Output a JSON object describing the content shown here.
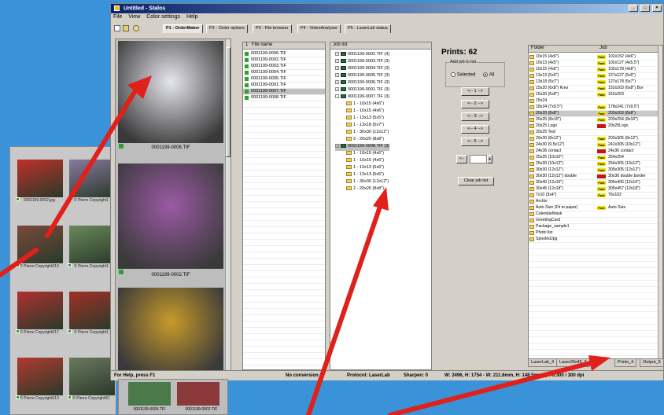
{
  "window": {
    "title": "Untitled - Stalos",
    "controls": [
      "_",
      "□",
      "×"
    ]
  },
  "menu": [
    "File",
    "View",
    "Color settings",
    "Help"
  ],
  "tabs": [
    "P1 - OrderMaker",
    "P2 - Order options",
    "P3 - File browser",
    "P4 - VideoAnalyser",
    "P5 - LaserLab status"
  ],
  "thumbnails": [
    {
      "caption": "0001199-0006.TIF",
      "color": "#e6e6ee"
    },
    {
      "caption": "0001199-0002.TIF",
      "color": "#9b5aa5"
    },
    {
      "caption": "",
      "color": "#c89a2a"
    }
  ],
  "bg_thumbnails": [
    {
      "caption": "0001199-0002.jpg",
      "color": "#c0302a"
    },
    {
      "caption": "© Pierre Copyright1",
      "color": "#8a7aa0"
    },
    {
      "caption": "© Pierre Copyright013",
      "color": "#7a4a3a"
    },
    {
      "caption": "© Pierre Copyright1",
      "color": "#6a8a5a"
    },
    {
      "caption": "© Pierre Copyright017",
      "color": "#b03030"
    },
    {
      "caption": "© Pierre Copyright1",
      "color": "#a03028"
    },
    {
      "caption": "© Pierre Copyright013",
      "color": "#b23a30"
    },
    {
      "caption": "© Pierre Copyright0C",
      "color": "#6a7a60"
    }
  ],
  "overlap_captions": [
    "0001199-0006.TIF",
    "0001199-0002.TIF"
  ],
  "filelist": {
    "header": "File name",
    "rows": [
      "0001199-0006.TIF",
      "0001199-0002.TIF",
      "0001199-0003.TIF",
      "0001199-0004.TIF",
      "0001199-0005.TIF",
      "0001199-0001.TIF",
      "0001199-0007.TIF",
      "0001199-0008.TIF"
    ],
    "selected_index": 6
  },
  "joblist": {
    "header": "Job list",
    "rows": [
      {
        "level": 0,
        "pm": "+",
        "text": "0001199-0002.TIF (3)"
      },
      {
        "level": 0,
        "pm": "+",
        "text": "0001199-0003.TIF (3)"
      },
      {
        "level": 0,
        "pm": "+",
        "text": "0001199-0004.TIF (3)"
      },
      {
        "level": 0,
        "pm": "+",
        "text": "0001199-0005.TIF (3)"
      },
      {
        "level": 0,
        "pm": "+",
        "text": "0001199-0006.TIF (3)"
      },
      {
        "level": 0,
        "pm": "+",
        "text": "0001199-0001.TIF (3)"
      },
      {
        "level": 0,
        "pm": "-",
        "text": "0001199-0007.TIF (3)"
      },
      {
        "level": 1,
        "pm": "",
        "text": "1 - 10x15 (4x6\")"
      },
      {
        "level": 1,
        "pm": "",
        "text": "1 - 10x15 (4x6\")"
      },
      {
        "level": 1,
        "pm": "",
        "text": "1 - 13x13 (5x5\")"
      },
      {
        "level": 1,
        "pm": "",
        "text": "1 - 13x18 (5x7\")"
      },
      {
        "level": 1,
        "pm": "",
        "text": "1 - 30x30 (12x12\")"
      },
      {
        "level": 1,
        "pm": "",
        "text": "2 - 20x20 (8x8\")"
      },
      {
        "level": 0,
        "pm": "-",
        "text": "0001199-0008.TIF (3)",
        "sel": true
      },
      {
        "level": 1,
        "pm": "",
        "text": "1 - 10x15 (4x6\")"
      },
      {
        "level": 1,
        "pm": "",
        "text": "1 - 10x15 (4x6\")"
      },
      {
        "level": 1,
        "pm": "",
        "text": "1 - 13x13 (5x5\")"
      },
      {
        "level": 1,
        "pm": "",
        "text": "1 - 13x13 (5x5\")"
      },
      {
        "level": 1,
        "pm": "",
        "text": "1 - 30x30 (12x12\")"
      },
      {
        "level": 1,
        "pm": "",
        "text": "2 - 20x20 (8x8\")"
      }
    ]
  },
  "prints": {
    "label": "Prints: 62",
    "addjob_label": "Add job to list",
    "radio_selected": "Selected",
    "radio_all": "All",
    "count_buttons": [
      "<-- 1 -->",
      "<-- 2 -->",
      "<-- 3 -->",
      "<-- 4 -->",
      "<-- 5 -->"
    ],
    "custom_button": "<--",
    "clear_button": "Clear job list"
  },
  "folders": {
    "header_folder": "Folder",
    "header_job": "Job",
    "rows": [
      {
        "folder": "10x15 (4x6\")",
        "badge": "Fast",
        "job": "102x152 (4x6\")"
      },
      {
        "folder": "10x13 (4x5\")",
        "badge": "Fast",
        "job": "102x127 (4x5.5\")"
      },
      {
        "folder": "10x15 (4x6\")",
        "badge": "Fast",
        "job": "102x178 (4x6\")"
      },
      {
        "folder": "13x13 (5x5\")",
        "badge": "Fast",
        "job": "127x127 (5x5\")"
      },
      {
        "folder": "13x18 (5x7\")",
        "badge": "Fast",
        "job": "127x178 (5x7\")"
      },
      {
        "folder": "15x20 (6x8\") Kres",
        "badge": "Fast",
        "job": "152x203 (6x8\") Bor"
      },
      {
        "folder": "15x20 (6x8\")",
        "badge": "Fast",
        "job": "152x203"
      },
      {
        "folder": "15x24",
        "badge": "",
        "job": ""
      },
      {
        "folder": "18x24 (7x9.5\")",
        "badge": "Fast",
        "job": "178x241 (7x9.5\")"
      },
      {
        "folder": "20x20 (8x8\")",
        "badge": "Fast",
        "job": "203x203 (8x8\")",
        "sel": true
      },
      {
        "folder": "20x25 (8x10\")",
        "badge": "Fast",
        "job": "203x254 (8x10\")"
      },
      {
        "folder": "20x25 Logo",
        "badge": "red",
        "job": "20x25Logo"
      },
      {
        "folder": "20x25 Test",
        "badge": "",
        "job": ""
      },
      {
        "folder": "20x30 (8x12\")",
        "badge": "Fast",
        "job": "203x305 (8x12\")"
      },
      {
        "folder": "24x30 (9.5x12\")",
        "badge": "Fast",
        "job": "241x305 (10x12\")"
      },
      {
        "folder": "24x36 contact",
        "badge": "red",
        "job": "24x36 contact"
      },
      {
        "folder": "25x25 (10x10\")",
        "badge": "Fast",
        "job": "254x254"
      },
      {
        "folder": "25x30 (10x12\")",
        "badge": "Fast",
        "job": "254x305 (10x12\")"
      },
      {
        "folder": "30x30 (12x12\")",
        "badge": "Fast",
        "job": "305x305 (12x12\")"
      },
      {
        "folder": "30x30 (12x12\") double",
        "badge": "red",
        "job": "30x30 double border"
      },
      {
        "folder": "30x40 (12x16\")",
        "badge": "Fast",
        "job": "305x406 (12x16\")"
      },
      {
        "folder": "30x45 (12x18\")",
        "badge": "Fast",
        "job": "305x457 (12x18\")"
      },
      {
        "folder": "7x10 (3x4\")",
        "badge": "Fast",
        "job": "76x102"
      },
      {
        "folder": "Archiv",
        "badge": "",
        "job": ""
      },
      {
        "folder": "Auto Size (Fit to paper)",
        "badge": "Fast",
        "job": "Auto Size"
      },
      {
        "folder": "CalendarMask",
        "badge": "",
        "job": ""
      },
      {
        "folder": "GreetingCard",
        "badge": "",
        "job": ""
      },
      {
        "folder": "Package_sample1",
        "badge": "",
        "job": ""
      },
      {
        "folder": "Photo list",
        "badge": "",
        "job": ""
      },
      {
        "folder": "SpooledJpg",
        "badge": "",
        "job": ""
      }
    ]
  },
  "bottom_tabs": [
    "LaserLab_4",
    "Laser30x45_5",
    "Prints_4",
    "Output_5"
  ],
  "status": {
    "help": "For Help, press F1",
    "conversion": "No conversion",
    "protocol": "Protocol: LaserLab",
    "sharpen": "Sharpen: 0",
    "dims": "W: 2496, H: 1754 - W: 211.6mm, H: 148.5mm @ 76.300 / 300 dpi"
  },
  "colors": {
    "desktop": "#3a93d8",
    "arrow": "#e0201a",
    "title_start": "#0a246a",
    "title_end": "#a6caf0"
  }
}
